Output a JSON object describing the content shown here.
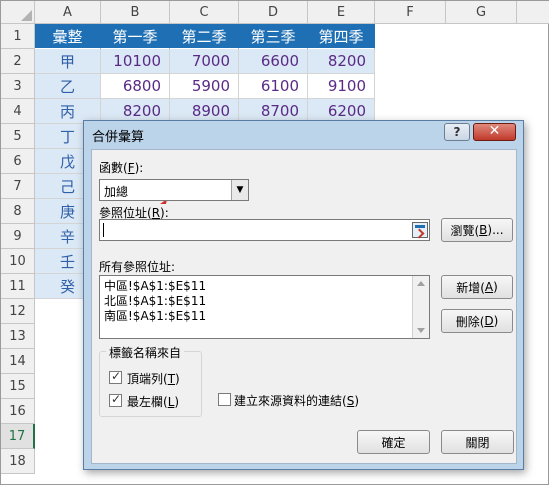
{
  "columns": [
    "A",
    "B",
    "C",
    "D",
    "E",
    "F",
    "G"
  ],
  "rows": [
    "1",
    "2",
    "3",
    "4",
    "5",
    "6",
    "7",
    "8",
    "9",
    "10",
    "11",
    "12",
    "13",
    "14",
    "15",
    "16",
    "17",
    "18"
  ],
  "selected_row": "17",
  "table": {
    "header": [
      "彙整",
      "第一季",
      "第二季",
      "第三季",
      "第四季"
    ],
    "names": [
      "甲",
      "乙",
      "丙",
      "丁",
      "戊",
      "己",
      "庚",
      "辛",
      "壬",
      "癸"
    ],
    "values": [
      [
        "10100",
        "7000",
        "6600",
        "8200"
      ],
      [
        "6800",
        "5900",
        "6100",
        "9100"
      ],
      [
        "8200",
        "8900",
        "8700",
        "6200"
      ]
    ]
  },
  "dialog": {
    "title": "合併彙算",
    "help_label": "?",
    "close_label": "✕",
    "function_label": "函數(",
    "function_hotkey": "F",
    "function_label_end": "):",
    "function_value": "加總",
    "reference_label": "參照位址(",
    "reference_hotkey": "R",
    "reference_label_end": "):",
    "reference_value": "",
    "browse_label": "瀏覽(",
    "browse_hotkey": "B",
    "browse_label_end": ")...",
    "all_refs_label": "所有參照位址:",
    "all_refs": [
      "中區!$A$1:$E$11",
      "北區!$A$1:$E$11",
      "南區!$A$1:$E$11"
    ],
    "add_label": "新增(",
    "add_hotkey": "A",
    "add_label_end": ")",
    "delete_label": "刪除(",
    "delete_hotkey": "D",
    "delete_label_end": ")",
    "group_title": "標籤名稱來自",
    "top_row_label": "頂端列(",
    "top_row_hotkey": "T",
    "top_row_label_end": ")",
    "left_col_label": "最左欄(",
    "left_col_hotkey": "L",
    "left_col_label_end": ")",
    "link_label": "建立來源資料的連結(",
    "link_hotkey": "S",
    "link_label_end": ")",
    "ok_label": "確定",
    "close_button_label": "關閉",
    "top_row_checked": true,
    "left_col_checked": true,
    "link_checked": false
  },
  "colors": {
    "header_fill": "#1f6fb5",
    "band_fill": "#dbe8f5",
    "number_text": "#5a2a86",
    "name_text": "#3060a8",
    "pointer_arrow": "#d0312d"
  }
}
